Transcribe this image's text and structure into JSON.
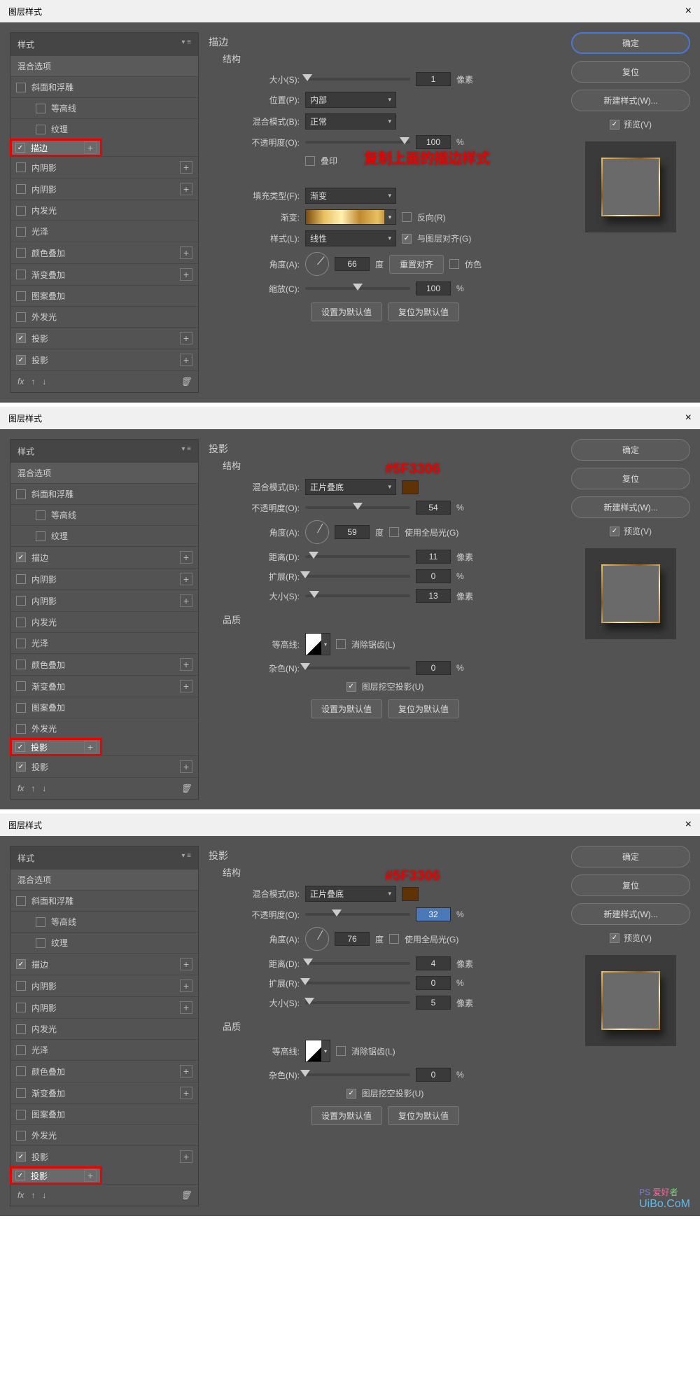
{
  "dialogs": [
    {
      "title": "图层样式",
      "stylesHeader": "样式",
      "blendHeader": "混合选项",
      "annotation": "复制上面的描边样式",
      "items": [
        {
          "label": "斜面和浮雕",
          "checked": false,
          "plus": false
        },
        {
          "label": "等高线",
          "checked": false,
          "plus": false,
          "indent": true
        },
        {
          "label": "纹理",
          "checked": false,
          "plus": false,
          "indent": true
        },
        {
          "label": "描边",
          "checked": true,
          "plus": true,
          "sel": true,
          "hl": true
        },
        {
          "label": "内阴影",
          "checked": false,
          "plus": true
        },
        {
          "label": "内阴影",
          "checked": false,
          "plus": true
        },
        {
          "label": "内发光",
          "checked": false,
          "plus": false
        },
        {
          "label": "光泽",
          "checked": false,
          "plus": false
        },
        {
          "label": "颜色叠加",
          "checked": false,
          "plus": true
        },
        {
          "label": "渐变叠加",
          "checked": false,
          "plus": true
        },
        {
          "label": "图案叠加",
          "checked": false,
          "plus": false
        },
        {
          "label": "外发光",
          "checked": false,
          "plus": false
        },
        {
          "label": "投影",
          "checked": true,
          "plus": true
        },
        {
          "label": "投影",
          "checked": true,
          "plus": true
        }
      ],
      "panel": {
        "title": "描边",
        "sub": "结构",
        "size": {
          "label": "大小(S):",
          "val": "1",
          "unit": "像素",
          "pos": 2
        },
        "position": {
          "label": "位置(P):",
          "val": "内部"
        },
        "blend": {
          "label": "混合模式(B):",
          "val": "正常"
        },
        "opacity": {
          "label": "不透明度(O):",
          "val": "100",
          "unit": "%",
          "pos": 95
        },
        "overprint": {
          "label": "叠印"
        },
        "fillType": {
          "label": "填充类型(F):",
          "val": "渐变"
        },
        "gradient": {
          "label": "渐变:",
          "reverse": "反向(R)"
        },
        "style": {
          "label": "样式(L):",
          "val": "线性",
          "align": "与图层对齐(G)"
        },
        "angle": {
          "label": "角度(A):",
          "val": "66",
          "unit": "度",
          "reset": "重置对齐",
          "dither": "仿色"
        },
        "scale": {
          "label": "缩放(C):",
          "val": "100",
          "unit": "%",
          "pos": 50
        },
        "btnDefault": "设置为默认值",
        "btnReset": "复位为默认值"
      }
    },
    {
      "title": "图层样式",
      "stylesHeader": "样式",
      "blendHeader": "混合选项",
      "colorAnno": "#5F3306",
      "items": [
        {
          "label": "斜面和浮雕",
          "checked": false,
          "plus": false
        },
        {
          "label": "等高线",
          "checked": false,
          "plus": false,
          "indent": true
        },
        {
          "label": "纹理",
          "checked": false,
          "plus": false,
          "indent": true
        },
        {
          "label": "描边",
          "checked": true,
          "plus": true
        },
        {
          "label": "内阴影",
          "checked": false,
          "plus": true
        },
        {
          "label": "内阴影",
          "checked": false,
          "plus": true
        },
        {
          "label": "内发光",
          "checked": false,
          "plus": false
        },
        {
          "label": "光泽",
          "checked": false,
          "plus": false
        },
        {
          "label": "颜色叠加",
          "checked": false,
          "plus": true
        },
        {
          "label": "渐变叠加",
          "checked": false,
          "plus": true
        },
        {
          "label": "图案叠加",
          "checked": false,
          "plus": false
        },
        {
          "label": "外发光",
          "checked": false,
          "plus": false
        },
        {
          "label": "投影",
          "checked": true,
          "plus": true,
          "sel": true,
          "hl": true
        },
        {
          "label": "投影",
          "checked": true,
          "plus": true
        }
      ],
      "panel": {
        "title": "投影",
        "sub": "结构",
        "blend": {
          "label": "混合模式(B):",
          "val": "正片叠底",
          "swatch": "#5F3306"
        },
        "opacity": {
          "label": "不透明度(O):",
          "val": "54",
          "unit": "%",
          "pos": 50
        },
        "angle": {
          "label": "角度(A):",
          "val": "59",
          "unit": "度",
          "global": "使用全局光(G)"
        },
        "distance": {
          "label": "距离(D):",
          "val": "11",
          "unit": "像素",
          "pos": 8
        },
        "spread": {
          "label": "扩展(R):",
          "val": "0",
          "unit": "%",
          "pos": 0
        },
        "size": {
          "label": "大小(S):",
          "val": "13",
          "unit": "像素",
          "pos": 9
        },
        "qualityTitle": "品质",
        "contour": {
          "label": "等高线:",
          "aa": "消除锯齿(L)"
        },
        "noise": {
          "label": "杂色(N):",
          "val": "0",
          "unit": "%",
          "pos": 0
        },
        "knockout": {
          "label": "图层挖空投影(U)",
          "on": true
        },
        "btnDefault": "设置为默认值",
        "btnReset": "复位为默认值"
      }
    },
    {
      "title": "图层样式",
      "stylesHeader": "样式",
      "blendHeader": "混合选项",
      "colorAnno": "#5F3306",
      "items": [
        {
          "label": "斜面和浮雕",
          "checked": false,
          "plus": false
        },
        {
          "label": "等高线",
          "checked": false,
          "plus": false,
          "indent": true
        },
        {
          "label": "纹理",
          "checked": false,
          "plus": false,
          "indent": true
        },
        {
          "label": "描边",
          "checked": true,
          "plus": true
        },
        {
          "label": "内阴影",
          "checked": false,
          "plus": true
        },
        {
          "label": "内阴影",
          "checked": false,
          "plus": true
        },
        {
          "label": "内发光",
          "checked": false,
          "plus": false
        },
        {
          "label": "光泽",
          "checked": false,
          "plus": false
        },
        {
          "label": "颜色叠加",
          "checked": false,
          "plus": true
        },
        {
          "label": "渐变叠加",
          "checked": false,
          "plus": true
        },
        {
          "label": "图案叠加",
          "checked": false,
          "plus": false
        },
        {
          "label": "外发光",
          "checked": false,
          "plus": false
        },
        {
          "label": "投影",
          "checked": true,
          "plus": true
        },
        {
          "label": "投影",
          "checked": true,
          "plus": true,
          "sel": true,
          "hl": true
        }
      ],
      "panel": {
        "title": "投影",
        "sub": "结构",
        "blend": {
          "label": "混合模式(B):",
          "val": "正片叠底",
          "swatch": "#5F3306"
        },
        "opacity": {
          "label": "不透明度(O):",
          "val": "32",
          "unit": "%",
          "pos": 30,
          "selblue": true
        },
        "angle": {
          "label": "角度(A):",
          "val": "76",
          "unit": "度",
          "global": "使用全局光(G)"
        },
        "distance": {
          "label": "距离(D):",
          "val": "4",
          "unit": "像素",
          "pos": 3
        },
        "spread": {
          "label": "扩展(R):",
          "val": "0",
          "unit": "%",
          "pos": 0
        },
        "size": {
          "label": "大小(S):",
          "val": "5",
          "unit": "像素",
          "pos": 4
        },
        "qualityTitle": "品质",
        "contour": {
          "label": "等高线:",
          "aa": "消除锯齿(L)"
        },
        "noise": {
          "label": "杂色(N):",
          "val": "0",
          "unit": "%",
          "pos": 0
        },
        "knockout": {
          "label": "图层挖空投影(U)",
          "on": true
        },
        "btnDefault": "设置为默认值",
        "btnReset": "复位为默认值"
      },
      "watermark": {
        "a": "PS",
        "b": "爱好",
        "c": "者",
        "site": "UiBo.CoM"
      }
    }
  ],
  "right": {
    "ok": "确定",
    "cancel": "复位",
    "newStyle": "新建样式(W)...",
    "preview": "预览(V)"
  }
}
